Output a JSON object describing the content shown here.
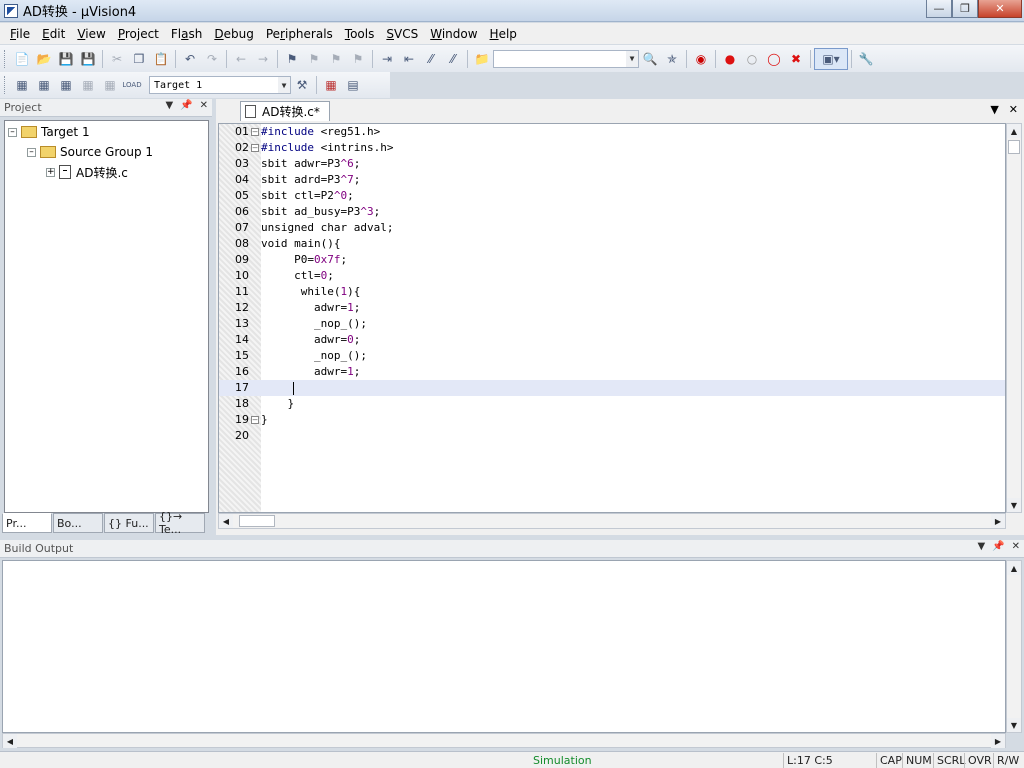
{
  "window": {
    "title": "AD转换 - μVision4"
  },
  "menu": [
    {
      "label": "File",
      "key": "F"
    },
    {
      "label": "Edit",
      "key": "E"
    },
    {
      "label": "View",
      "key": "V"
    },
    {
      "label": "Project",
      "key": "P"
    },
    {
      "label": "Flash",
      "key": "a"
    },
    {
      "label": "Debug",
      "key": "D"
    },
    {
      "label": "Peripherals",
      "key": "r"
    },
    {
      "label": "Tools",
      "key": "T"
    },
    {
      "label": "SVCS",
      "key": "S"
    },
    {
      "label": "Window",
      "key": "W"
    },
    {
      "label": "Help",
      "key": "H"
    }
  ],
  "toolbar2": {
    "target_select": "Target 1"
  },
  "project_pane": {
    "title": "Project",
    "tree": {
      "target": "Target 1",
      "group": "Source Group 1",
      "file": "AD转换.c"
    },
    "tabs": [
      "Pr...",
      "Bo...",
      "{} Fu...",
      "{}→ Te..."
    ]
  },
  "editor": {
    "tab_label": "AD转换.c*",
    "cursor_line": 17,
    "lines": [
      {
        "n": "01",
        "html": "<span class=\"pp\">#include</span> &lt;reg51.h&gt;",
        "fold": "-"
      },
      {
        "n": "02",
        "html": "<span class=\"pp\">#include</span> &lt;intrins.h&gt;",
        "fold": "-"
      },
      {
        "n": "03",
        "html": "sbit adwr=P3<span class=\"num\">^6</span>;"
      },
      {
        "n": "04",
        "html": "sbit adrd=P3<span class=\"num\">^7</span>;"
      },
      {
        "n": "05",
        "html": "sbit ctl=P2<span class=\"num\">^0</span>;"
      },
      {
        "n": "06",
        "html": "sbit ad_busy=P3<span class=\"num\">^3</span>;"
      },
      {
        "n": "07",
        "html": "unsigned char adval;"
      },
      {
        "n": "08",
        "html": "void main(){"
      },
      {
        "n": "09",
        "html": "     P0=<span class=\"num\">0x7f</span>;"
      },
      {
        "n": "10",
        "html": "     ctl=<span class=\"num\">0</span>;"
      },
      {
        "n": "11",
        "html": "      while(<span class=\"num\">1</span>){"
      },
      {
        "n": "12",
        "html": "        adwr=<span class=\"num\">1</span>;"
      },
      {
        "n": "13",
        "html": "        _nop_();"
      },
      {
        "n": "14",
        "html": "        adwr=<span class=\"num\">0</span>;"
      },
      {
        "n": "15",
        "html": "        _nop_();"
      },
      {
        "n": "16",
        "html": "        adwr=<span class=\"num\">1</span>;"
      },
      {
        "n": "17",
        "html": ""
      },
      {
        "n": "18",
        "html": "    }"
      },
      {
        "n": "19",
        "html": "}",
        "fold": "-"
      },
      {
        "n": "20",
        "html": ""
      }
    ]
  },
  "build_output": {
    "title": "Build Output",
    "text": ""
  },
  "status": {
    "mode": "Simulation",
    "position": "L:17 C:5",
    "cap": "CAP",
    "num": "NUM",
    "scrl": "SCRL",
    "ovr": "OVR",
    "rw": "R/W"
  }
}
